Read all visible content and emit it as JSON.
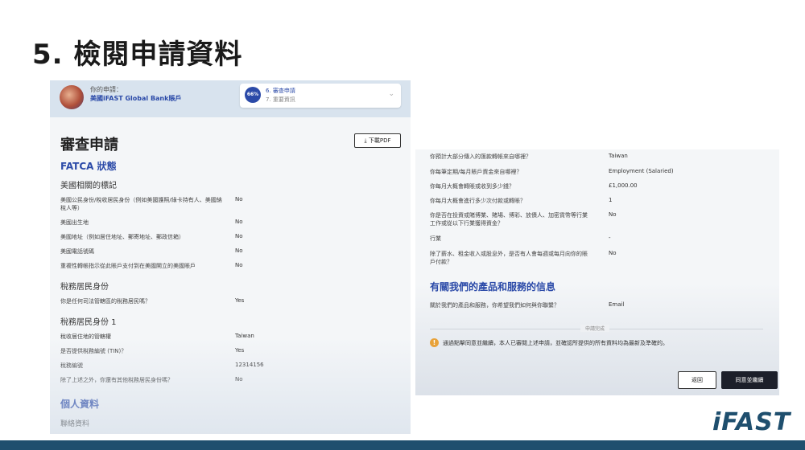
{
  "slide": {
    "title": "5. 檢閱申請資料",
    "brand": "iFAST"
  },
  "left": {
    "header": {
      "label": "你的申請：",
      "app_name": "美國iFAST Global Bank賬戶",
      "progress": "66%",
      "step_current": "6. 審查申請",
      "step_next": "7. 重要資訊"
    },
    "review_title": "審查申請",
    "pdf_button": "下載PDF",
    "fatca_title": "FATCA 狀態",
    "us_indicia_title": "美國相關的標記",
    "us_indicia_rows": [
      {
        "q": "美國公民身份/稅收居民身份（例如美國護照/綠卡持有人、美國納稅人等）",
        "a": "No"
      },
      {
        "q": "美國出生地",
        "a": "No"
      },
      {
        "q": "美國地址（例如居住地址、郵寄地址、郵政信箱）",
        "a": "No"
      },
      {
        "q": "美國電話號碼",
        "a": "No"
      },
      {
        "q": "重複性轉帳指示從此賬戶支付到在美國開立的美國賬戶",
        "a": "No"
      }
    ],
    "tax_residency_title": "稅務居民身份",
    "tax_residency_row": {
      "q": "你是任何司法管轄區的稅務居民嗎？",
      "a": "Yes"
    },
    "tax_residency_1_title": "稅務居民身份 1",
    "tax_residency_1_rows": [
      {
        "q": "稅收居住地的管轄權",
        "a": "Taiwan"
      },
      {
        "q": "是否提供稅務編號 (TIN)？",
        "a": "Yes"
      },
      {
        "q": "稅務編號",
        "a": "12314156"
      },
      {
        "q": "除了上述之外，你還有其他稅務居民身份嗎？",
        "a": "No"
      }
    ],
    "personal_title": "個人資料",
    "contact_title": "聯絡資料"
  },
  "right": {
    "rows": [
      {
        "q": "你預計大部分傳入的匯款轉帳來自哪裡？",
        "a": "Taiwan"
      },
      {
        "q": "你每筆定期/每月賬戶資金來自哪裡？",
        "a": "Employment (Salaried)"
      },
      {
        "q": "你每月大概會轉賬或收到多少錢？",
        "a": "£1,000.00"
      },
      {
        "q": "你每月大概會進行多少次付款或轉賬？",
        "a": "1"
      },
      {
        "q": "你是否在投資或賭博業、賭場、博彩、放債人、加密貨幣等行業工作或從以下行業獲得資金？",
        "a": "No"
      },
      {
        "q": "行業",
        "a": "-"
      },
      {
        "q": "除了薪水、租金收入或股息外，是否有人會每週或每月向你的賬戶付款？",
        "a": "No"
      }
    ],
    "products_title": "有關我們的產品和服務的信息",
    "contact_pref": {
      "q": "關於我們的產品和服務，你希望我們如何與你聯繫？",
      "a": "Email"
    },
    "divider_text": "申請完成",
    "confirm_text": "通過點擊同意並繼續，本人已審閱上述申請，並確認所提供的所有資料均為最新及準確的。",
    "back_button": "返回",
    "agree_button": "同意並繼續"
  }
}
